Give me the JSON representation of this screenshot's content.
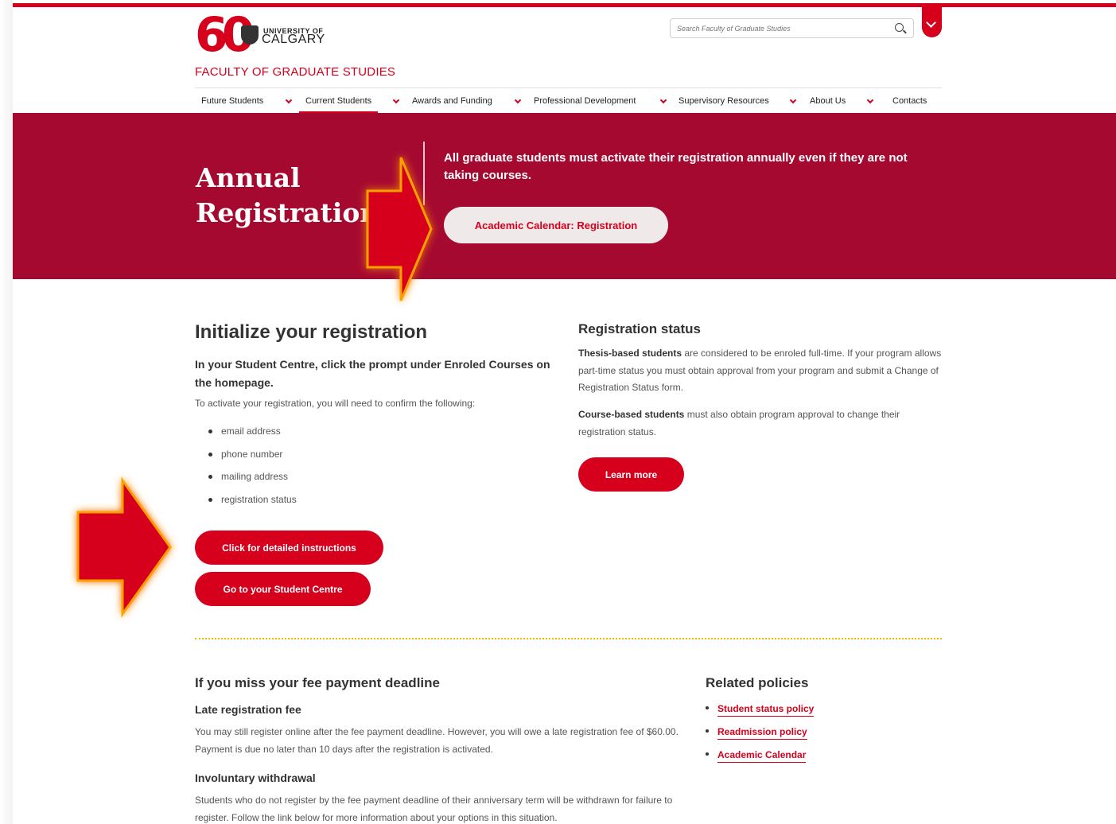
{
  "brand": {
    "logo_number": "60",
    "university_of": "UNIVERSITY OF",
    "calgary": "CALGARY",
    "faculty": "FACULTY OF GRADUATE STUDIES"
  },
  "search": {
    "placeholder": "Search Faculty of Graduate Studies"
  },
  "nav": {
    "items": [
      {
        "label": "Future Students"
      },
      {
        "label": "Current Students"
      },
      {
        "label": "Awards and Funding"
      },
      {
        "label": "Professional Development"
      },
      {
        "label": "Supervisory Resources"
      },
      {
        "label": "About Us"
      },
      {
        "label": "Contacts"
      }
    ]
  },
  "hero": {
    "title_line1": "Annual",
    "title_line2": "Registration",
    "text": "All graduate students must activate their registration annually even if they are not taking courses.",
    "button": "Academic Calendar: Registration"
  },
  "initialize": {
    "heading": "Initialize your registration",
    "bold_text": "In your Student Centre, click the prompt under Enroled Courses on the homepage.",
    "intro": "To activate your registration, you will need to confirm the following:",
    "items": [
      "email address",
      "phone number",
      "mailing address",
      "registration status"
    ],
    "btn_instructions": "Click for detailed instructions",
    "btn_centre": "Go to your Student Centre"
  },
  "status": {
    "heading": "Registration status",
    "thesis_bold": "Thesis-based students",
    "thesis_text": " are considered to be enroled full-time. If your program allows part-time status you must obtain approval from your program and submit a Change of Registration Status form.",
    "course_bold": "Course-based students",
    "course_text": " must also obtain program approval to change their registration status.",
    "btn_learn": "Learn more"
  },
  "deadline": {
    "heading": "If you miss your fee payment deadline",
    "late_heading": "Late registration fee",
    "late_text": "You may still register online after the fee payment deadline. However, you will owe a late registration fee of $60.00. Payment is due no later than 10 days after the registration is activated.",
    "withdraw_heading": "Involuntary withdrawal",
    "withdraw_text": "Students who do not register by the fee payment deadline of their anniversary term will be withdrawn for failure to register. Follow the link below for more information about your options in this situation."
  },
  "related": {
    "heading": "Related policies",
    "links": [
      "Student status policy",
      "Readmission policy",
      "Academic Calendar"
    ]
  },
  "colors": {
    "brand_red": "#d6001c",
    "hero_bg": "#a6092f",
    "dotted_rule": "#f2b900"
  }
}
